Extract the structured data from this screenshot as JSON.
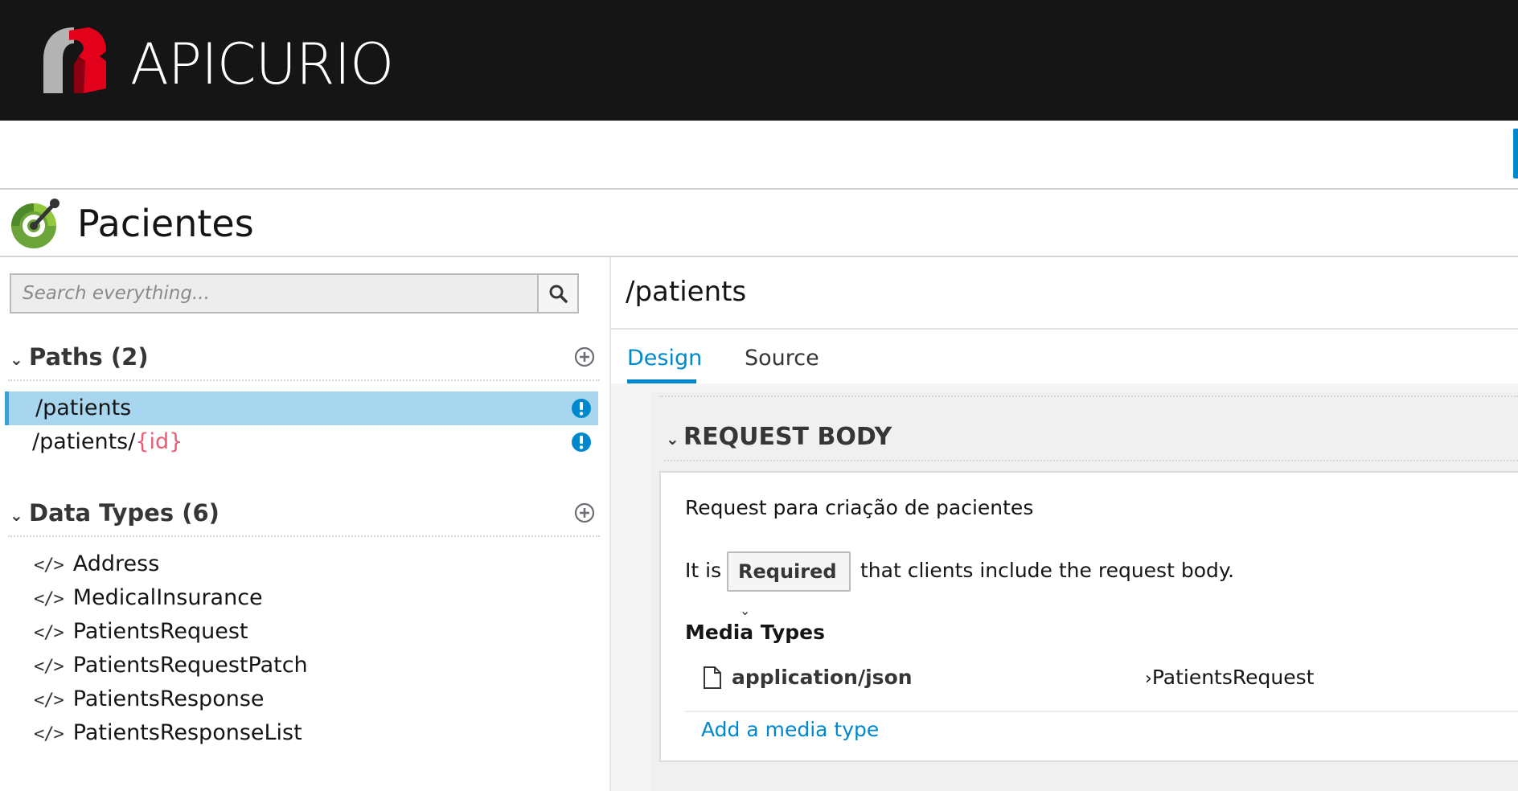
{
  "brand": {
    "name": "APICURIO"
  },
  "api": {
    "title": "Pacientes"
  },
  "search": {
    "placeholder": "Search everything..."
  },
  "paths_section": {
    "label": "Paths (2)",
    "items": [
      {
        "prefix": "/patients",
        "param": ""
      },
      {
        "prefix": "/patients/",
        "param": "{id}"
      }
    ]
  },
  "datatypes_section": {
    "label": "Data Types (6)",
    "items": [
      "Address",
      "MedicalInsurance",
      "PatientsRequest",
      "PatientsRequestPatch",
      "PatientsResponse",
      "PatientsResponseList"
    ]
  },
  "editor": {
    "title": "/patients",
    "tabs": [
      "Design",
      "Source"
    ],
    "active_tab": "Design"
  },
  "request_body": {
    "heading": "REQUEST BODY",
    "description": "Request para criação de pacientes",
    "it_is": "It is",
    "required": "Required",
    "clients_text": "that clients include the request body.",
    "media_types_heading": "Media Types",
    "media_type": "application/json",
    "schema": "PatientsRequest",
    "add_media_label": "Add a media type"
  },
  "colors": {
    "accent": "#0088ce",
    "active_row": "#a7d6ee",
    "param": "#e85d75",
    "header": "#151515"
  }
}
